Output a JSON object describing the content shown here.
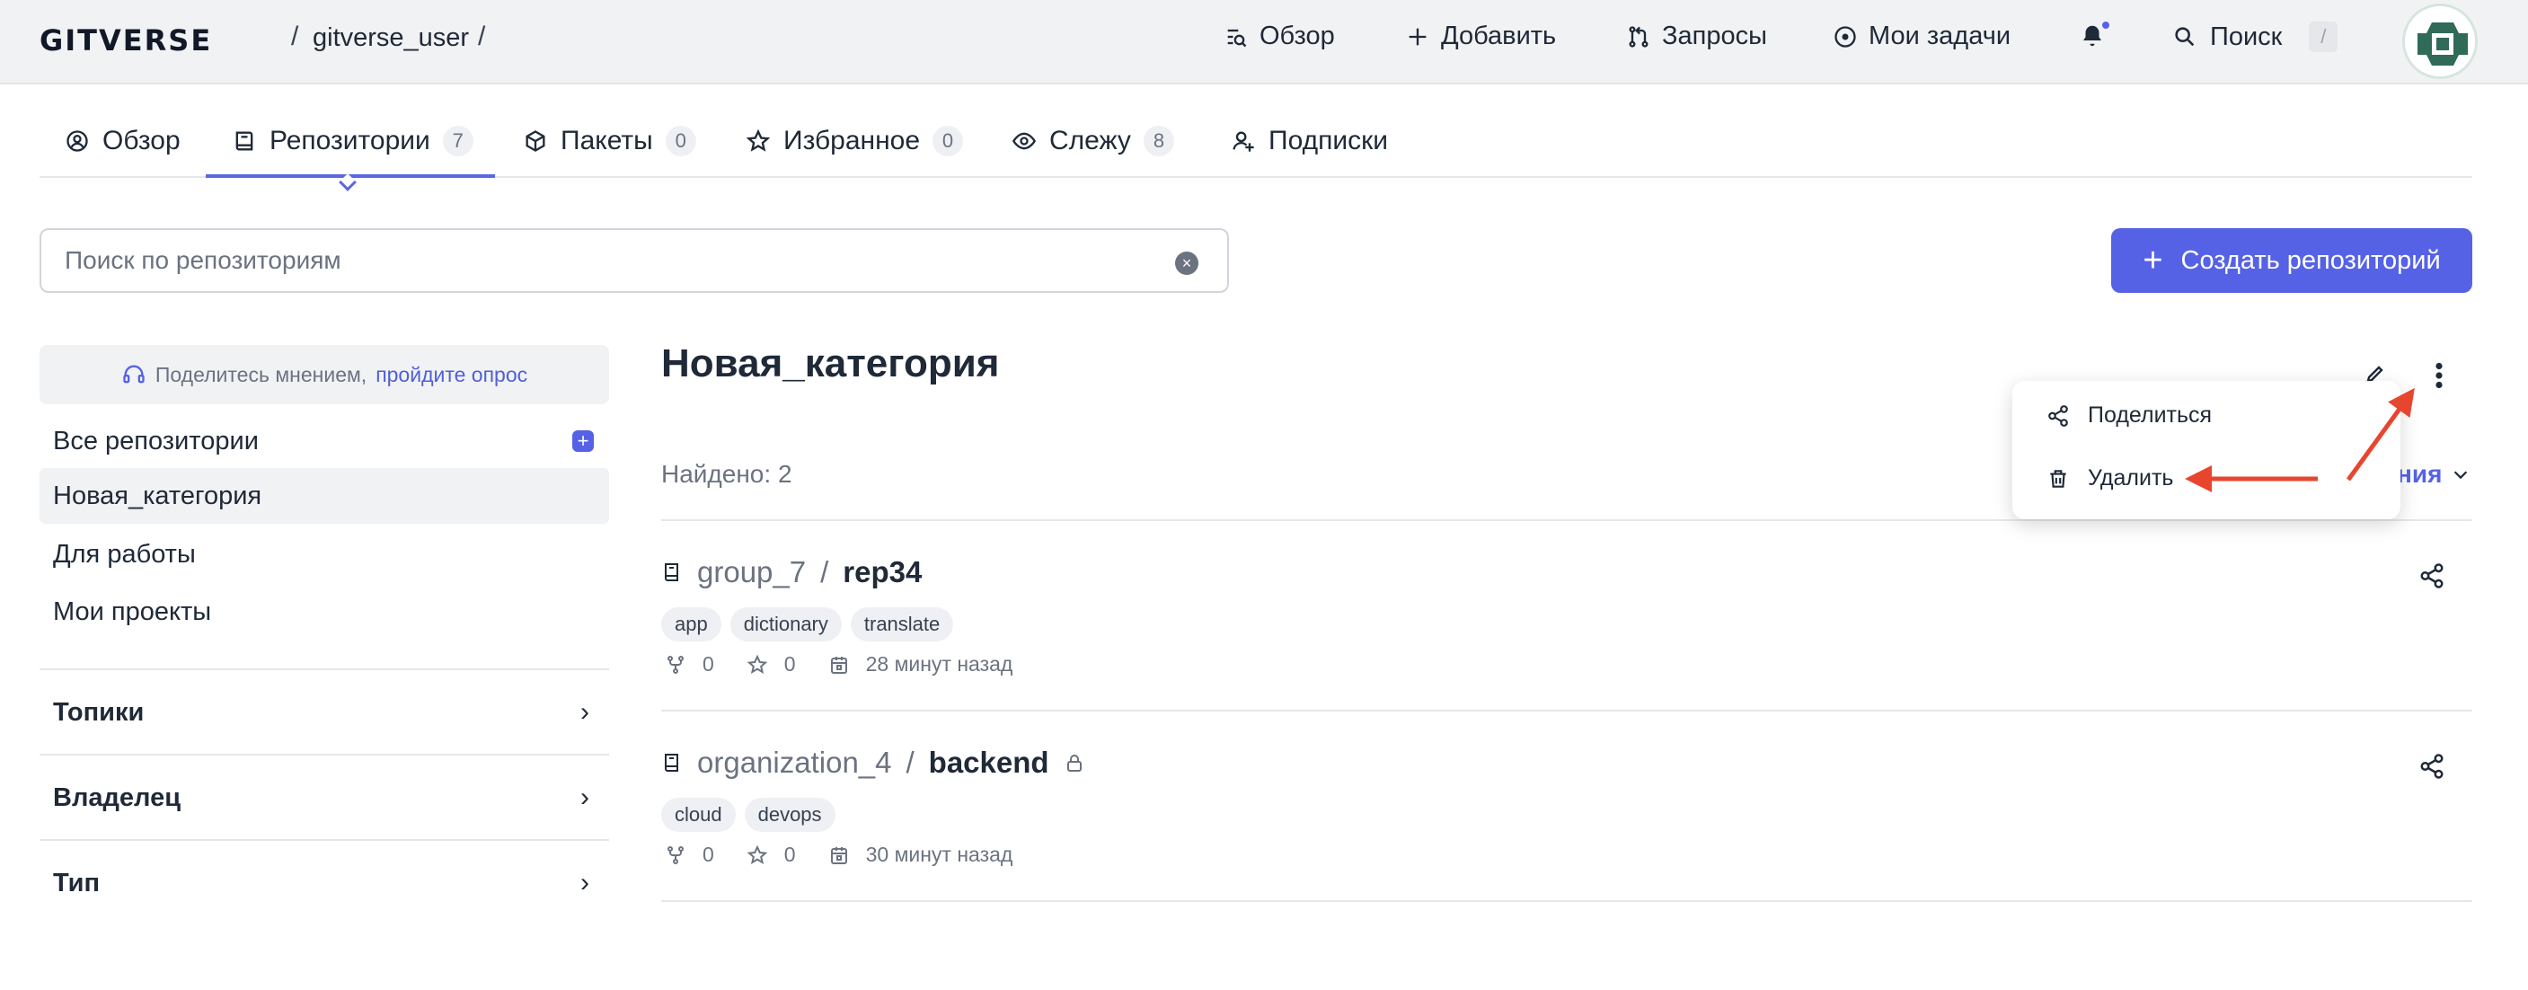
{
  "header": {
    "logo": "GITVERSE",
    "crumb_sep": "/",
    "user": "gitverse_user",
    "nav": [
      {
        "label": "Обзор",
        "icon": "overview-icon"
      },
      {
        "label": "Добавить",
        "icon": "plus-icon"
      },
      {
        "label": "Запросы",
        "icon": "pull-request-icon"
      },
      {
        "label": "Мои задачи",
        "icon": "issue-icon"
      }
    ],
    "search_label": "Поиск",
    "search_hotkey": "/"
  },
  "tabs": [
    {
      "label": "Обзор",
      "count": null,
      "icon": "user-circle-icon"
    },
    {
      "label": "Репозитории",
      "count": "7",
      "icon": "repo-icon"
    },
    {
      "label": "Пакеты",
      "count": "0",
      "icon": "package-icon"
    },
    {
      "label": "Избранное",
      "count": "0",
      "icon": "star-icon"
    },
    {
      "label": "Слежу",
      "count": "8",
      "icon": "eye-icon"
    },
    {
      "label": "Подписки",
      "count": null,
      "icon": "user-plus-icon"
    }
  ],
  "active_tab": "Репозитории",
  "search": {
    "placeholder": "Поиск по репозиториям",
    "value": ""
  },
  "create_button": "Создать репозиторий",
  "sidebar": {
    "survey_text": "Поделитесь мнением,",
    "survey_link": "пройдите опрос",
    "categories": [
      "Все репозитории",
      "Новая_категория",
      "Для работы",
      "Мои проекты"
    ],
    "active_category": "Новая_категория",
    "filters": [
      "Топики",
      "Владелец",
      "Тип"
    ]
  },
  "main": {
    "category_title": "Новая_категория",
    "found": "Найдено: 2",
    "sort_label_visible": "ния",
    "menu": {
      "share": "Поделиться",
      "delete": "Удалить"
    }
  },
  "repos": [
    {
      "owner": "group_7",
      "name": "rep34",
      "private": false,
      "tags": [
        "app",
        "dictionary",
        "translate"
      ],
      "forks": "0",
      "stars": "0",
      "updated": "28 минут назад"
    },
    {
      "owner": "organization_4",
      "name": "backend",
      "private": true,
      "tags": [
        "cloud",
        "devops"
      ],
      "forks": "0",
      "stars": "0",
      "updated": "30 минут назад"
    }
  ],
  "colors": {
    "accent": "#5662e6",
    "annotation_arrow": "#e8452f"
  }
}
